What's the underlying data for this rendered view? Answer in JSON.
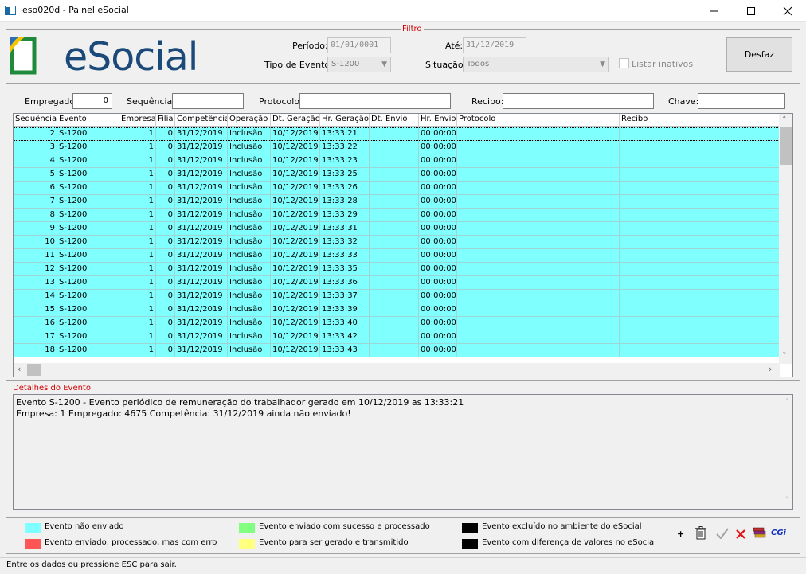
{
  "window": {
    "title": "eso020d - Painel eSocial",
    "minimize": "—",
    "maximize": "☐",
    "close": "✕"
  },
  "filter": {
    "legend": "Filtro",
    "logo_text": "eSocial",
    "periodo_label": "Período:",
    "periodo_value": "01/01/0001",
    "ate_label": "Até:",
    "ate_value": "31/12/2019",
    "tipo_label": "Tipo de Evento:",
    "tipo_value": "S-1200",
    "situacao_label": "Situação:",
    "situacao_value": "Todos",
    "listar_label": "Listar inativos",
    "desfaz_label": "Desfaz"
  },
  "search": {
    "empregado_label": "Empregado:",
    "empregado_value": "0",
    "sequencia_label": "Sequência:",
    "protocolo_label": "Protocolo:",
    "recibo_label": "Recibo:",
    "chave_label": "Chave:"
  },
  "grid": {
    "columns": [
      "Sequência",
      "Evento",
      "Empresa",
      "Filial",
      "Competência",
      "Operação",
      "Dt. Geração",
      "Hr. Geração",
      "Dt. Envio",
      "Hr. Envio",
      "Protocolo",
      "Recibo"
    ],
    "rows": [
      [
        "2",
        "S-1200",
        "1",
        "0",
        "31/12/2019",
        "Inclusão",
        "10/12/2019",
        "13:33:21",
        "",
        "00:00:00",
        "",
        ""
      ],
      [
        "3",
        "S-1200",
        "1",
        "0",
        "31/12/2019",
        "Inclusão",
        "10/12/2019",
        "13:33:22",
        "",
        "00:00:00",
        "",
        ""
      ],
      [
        "4",
        "S-1200",
        "1",
        "0",
        "31/12/2019",
        "Inclusão",
        "10/12/2019",
        "13:33:23",
        "",
        "00:00:00",
        "",
        ""
      ],
      [
        "5",
        "S-1200",
        "1",
        "0",
        "31/12/2019",
        "Inclusão",
        "10/12/2019",
        "13:33:25",
        "",
        "00:00:00",
        "",
        ""
      ],
      [
        "6",
        "S-1200",
        "1",
        "0",
        "31/12/2019",
        "Inclusão",
        "10/12/2019",
        "13:33:26",
        "",
        "00:00:00",
        "",
        ""
      ],
      [
        "7",
        "S-1200",
        "1",
        "0",
        "31/12/2019",
        "Inclusão",
        "10/12/2019",
        "13:33:28",
        "",
        "00:00:00",
        "",
        ""
      ],
      [
        "8",
        "S-1200",
        "1",
        "0",
        "31/12/2019",
        "Inclusão",
        "10/12/2019",
        "13:33:29",
        "",
        "00:00:00",
        "",
        ""
      ],
      [
        "9",
        "S-1200",
        "1",
        "0",
        "31/12/2019",
        "Inclusão",
        "10/12/2019",
        "13:33:31",
        "",
        "00:00:00",
        "",
        ""
      ],
      [
        "10",
        "S-1200",
        "1",
        "0",
        "31/12/2019",
        "Inclusão",
        "10/12/2019",
        "13:33:32",
        "",
        "00:00:00",
        "",
        ""
      ],
      [
        "11",
        "S-1200",
        "1",
        "0",
        "31/12/2019",
        "Inclusão",
        "10/12/2019",
        "13:33:33",
        "",
        "00:00:00",
        "",
        ""
      ],
      [
        "12",
        "S-1200",
        "1",
        "0",
        "31/12/2019",
        "Inclusão",
        "10/12/2019",
        "13:33:35",
        "",
        "00:00:00",
        "",
        ""
      ],
      [
        "13",
        "S-1200",
        "1",
        "0",
        "31/12/2019",
        "Inclusão",
        "10/12/2019",
        "13:33:36",
        "",
        "00:00:00",
        "",
        ""
      ],
      [
        "14",
        "S-1200",
        "1",
        "0",
        "31/12/2019",
        "Inclusão",
        "10/12/2019",
        "13:33:37",
        "",
        "00:00:00",
        "",
        ""
      ],
      [
        "15",
        "S-1200",
        "1",
        "0",
        "31/12/2019",
        "Inclusão",
        "10/12/2019",
        "13:33:39",
        "",
        "00:00:00",
        "",
        ""
      ],
      [
        "16",
        "S-1200",
        "1",
        "0",
        "31/12/2019",
        "Inclusão",
        "10/12/2019",
        "13:33:40",
        "",
        "00:00:00",
        "",
        ""
      ],
      [
        "17",
        "S-1200",
        "1",
        "0",
        "31/12/2019",
        "Inclusão",
        "10/12/2019",
        "13:33:42",
        "",
        "00:00:00",
        "",
        ""
      ],
      [
        "18",
        "S-1200",
        "1",
        "0",
        "31/12/2019",
        "Inclusão",
        "10/12/2019",
        "13:33:43",
        "",
        "00:00:00",
        "",
        ""
      ]
    ]
  },
  "details": {
    "label": "Detalhes do Evento",
    "line1": "Evento S-1200 - Evento periódico de remuneração do trabalhador gerado em 10/12/2019 as 13:33:21",
    "line2": "Empresa: 1 Empregado: 4675 Competência: 31/12/2019 ainda não enviado!"
  },
  "legend": {
    "items": [
      {
        "label": "Evento não enviado",
        "color": "#80ffff"
      },
      {
        "label": "Evento enviado, processado, mas com erro",
        "color": "#ff5555"
      },
      {
        "label": "Evento enviado com sucesso e processado",
        "color": "#80ff80"
      },
      {
        "label": "Evento para ser gerado e transmitido",
        "color": "#ffff80"
      },
      {
        "label": "Evento excluído no ambiente do eSocial",
        "color": "#000000"
      },
      {
        "label": "Evento com diferença de valores no eSocial",
        "color": "#000000"
      }
    ],
    "toolbar": {
      "plus": "+",
      "cgi": "CGi"
    }
  },
  "status": {
    "text": "Entre os dados ou pressione ESC para sair."
  },
  "colors": {
    "row_pending": "#80ffff",
    "accent_red": "#d00000",
    "logo_blue": "#1b4a7a"
  }
}
